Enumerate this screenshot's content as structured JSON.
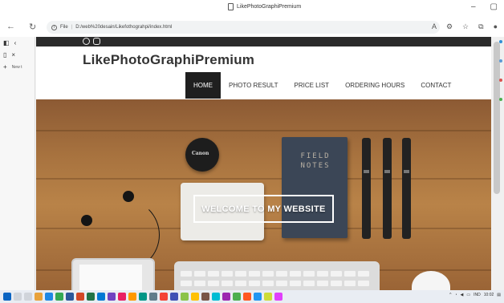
{
  "browser": {
    "tab_title": "LikePhotoGraphiPremium",
    "address_scheme": "File",
    "address_path": "D:/web%20desain/Likefothograhpi/index.html",
    "new_tab_label": "New t"
  },
  "site": {
    "brand": "LikePhotoGraphiPremium",
    "menu": [
      {
        "label": "HOME",
        "active": true
      },
      {
        "label": "PHOTO RESULT",
        "active": false
      },
      {
        "label": "PRICE LIST",
        "active": false
      },
      {
        "label": "ORDERING HOURS",
        "active": false
      },
      {
        "label": "CONTACT",
        "active": false
      }
    ],
    "hero_button": "WELCOME TO MY WEBSITE"
  },
  "hero_props": {
    "lens_brand": "Canon",
    "notebook_title": "FIELD NOTES"
  },
  "taskbar": {
    "lang": "IND",
    "time": "10:02"
  },
  "colors": {
    "topbar": "#2b2b2b",
    "menu_active_bg": "#1f1f1f",
    "brand_text": "#333333"
  }
}
